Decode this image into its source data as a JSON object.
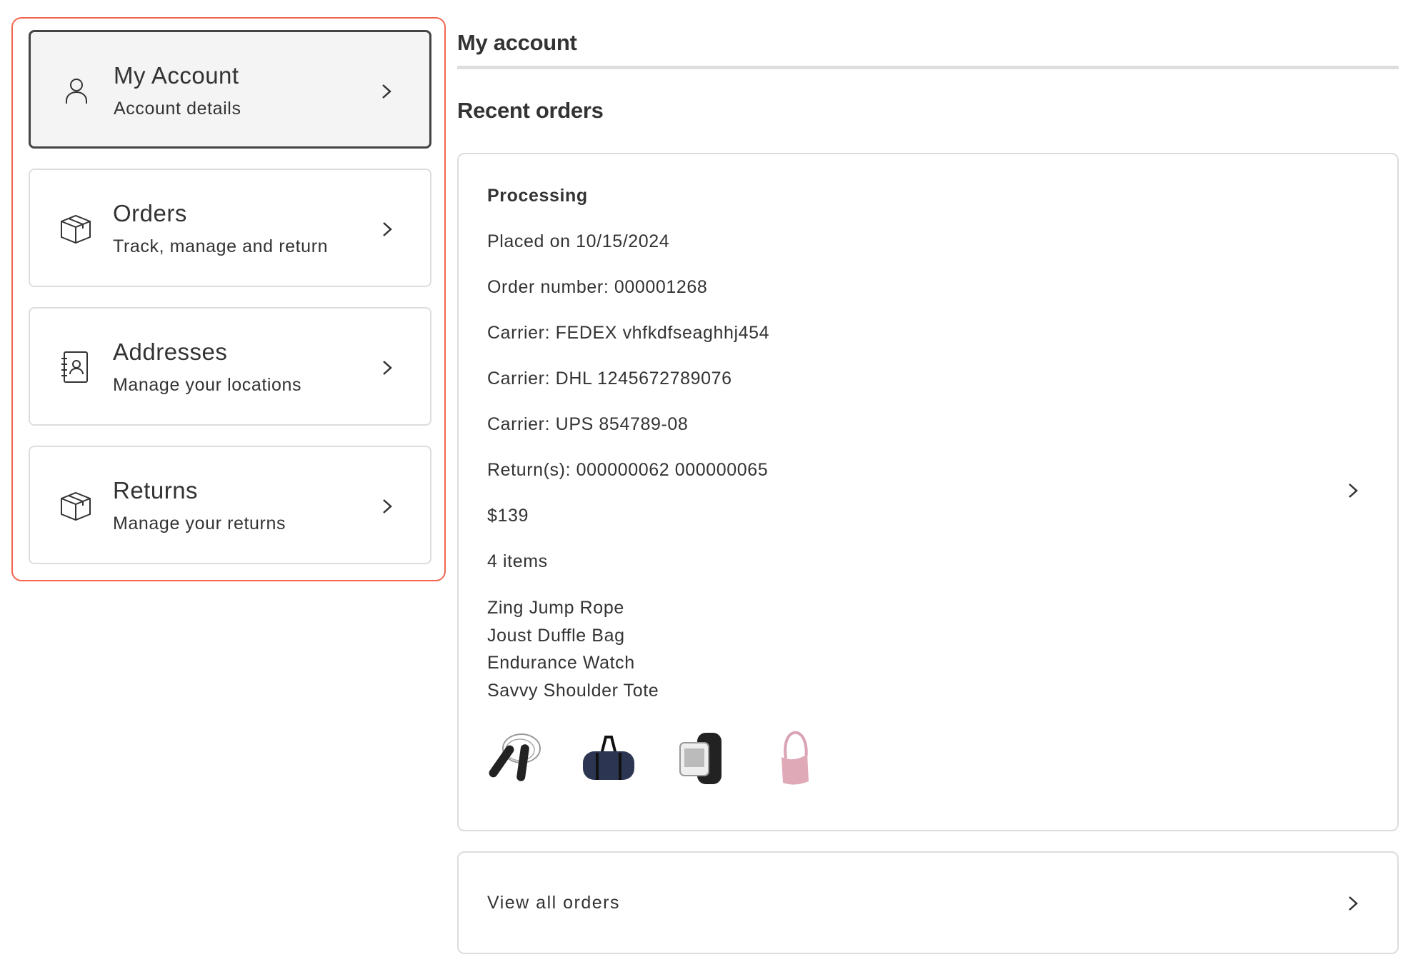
{
  "sidebar": {
    "items": [
      {
        "title": "My Account",
        "subtitle": "Account details",
        "icon": "user-icon",
        "active": true
      },
      {
        "title": "Orders",
        "subtitle": "Track, manage and return",
        "icon": "box-icon"
      },
      {
        "title": "Addresses",
        "subtitle": "Manage your locations",
        "icon": "address-book-icon"
      },
      {
        "title": "Returns",
        "subtitle": "Manage your returns",
        "icon": "box-icon"
      }
    ]
  },
  "main": {
    "title": "My account",
    "recent_orders_heading": "Recent orders",
    "order": {
      "status": "Processing",
      "placed": "Placed on 10/15/2024",
      "order_number": "Order number: 000001268",
      "carriers": [
        "Carrier: FEDEX vhfkdfseaghhj454",
        "Carrier: DHL 1245672789076",
        "Carrier: UPS 854789-08"
      ],
      "returns": "Return(s): 000000062 000000065",
      "total": "$139",
      "item_count": "4 items",
      "items": [
        "Zing Jump Rope",
        "Joust Duffle Bag",
        "Endurance Watch",
        "Savvy Shoulder Tote"
      ]
    },
    "view_all": "View all orders"
  },
  "colors": {
    "highlight": "#f26650",
    "active_border": "#444444",
    "border": "#dddddd"
  }
}
